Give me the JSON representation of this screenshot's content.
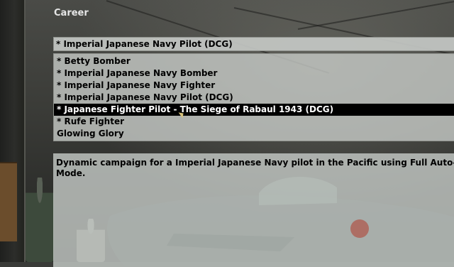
{
  "window": {
    "title": "Career"
  },
  "selected_campaign": "* Imperial Japanese Navy Pilot (DCG)",
  "campaign_list": {
    "items": [
      {
        "label": "* Betty Bomber",
        "selected": false
      },
      {
        "label": "* Imperial Japanese Navy Bomber",
        "selected": false
      },
      {
        "label": "* Imperial Japanese Navy Fighter",
        "selected": false
      },
      {
        "label": "* Imperial Japanese Navy Pilot (DCG)",
        "selected": false
      },
      {
        "label": "* Japanese Fighter Pilot - The Siege of Rabaul 1943 (DCG)",
        "selected": true
      },
      {
        "label": "* Rufe Fighter",
        "selected": false
      },
      {
        "label": "Glowing Glory",
        "selected": false
      }
    ]
  },
  "description": {
    "text": "Dynamic campaign for a Imperial Japanese Navy pilot in the Pacific using Full Auto-Mode."
  },
  "colors": {
    "selection_bg": "#000000",
    "selection_fg": "#ffffff",
    "panel_bg": "#c4c8c4",
    "roundel": "#b03a2a"
  }
}
